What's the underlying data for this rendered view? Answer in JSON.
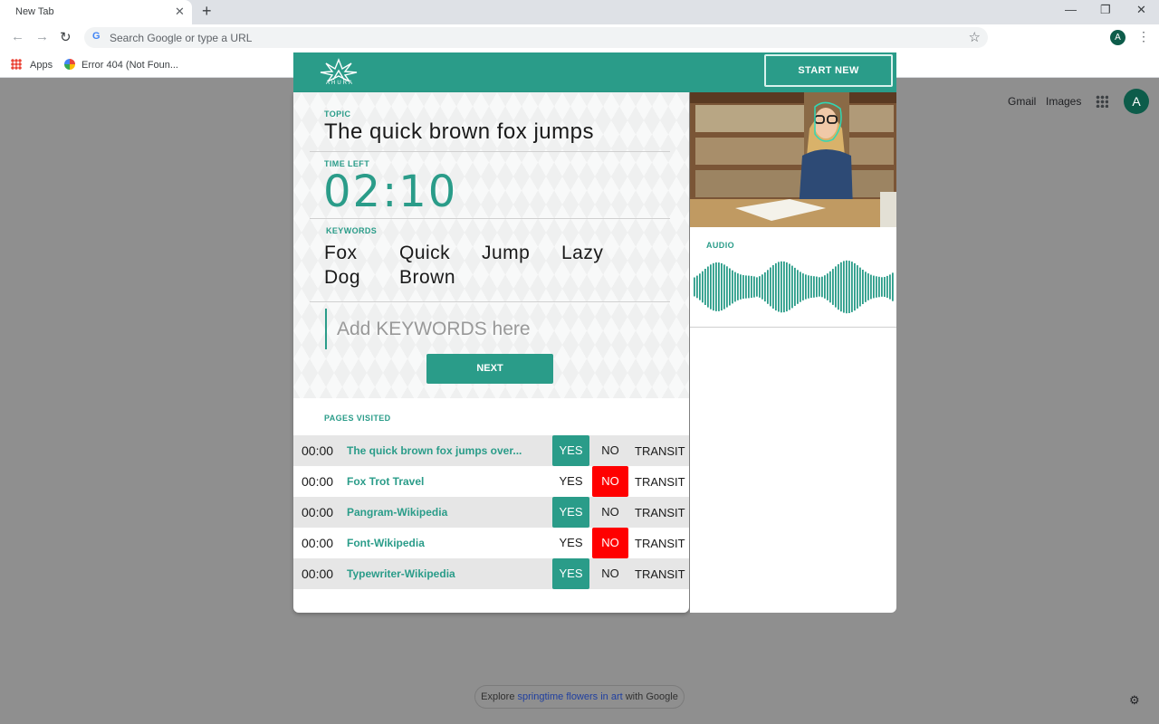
{
  "browser": {
    "tab_title": "New Tab",
    "tab_close": "✕",
    "new_tab": "+",
    "minimize": "—",
    "restore": "❐",
    "close": "✕",
    "back": "←",
    "forward": "→",
    "reload": "↻",
    "google_g": "G",
    "omnibox_placeholder": "Search Google or type a URL",
    "star": "☆",
    "profile_initial": "A",
    "menu": "⋮",
    "bookmarks": [
      {
        "label": "Apps"
      },
      {
        "label": "Error 404 (Not Foun..."
      }
    ]
  },
  "google": {
    "gmail": "Gmail",
    "images": "Images",
    "avatar_initial": "A",
    "explore_prefix": "Explore ",
    "explore_link": "springtime flowers in art",
    "explore_suffix": " with Google",
    "settings": "⚙"
  },
  "app": {
    "brand": "AHURA",
    "start_new": "START NEW",
    "topic_label": "TOPIC",
    "topic": "The quick brown fox jumps",
    "time_left_label": "TIME LEFT",
    "time_left": "02:10",
    "keywords_label": "KEYWORDS",
    "keywords": [
      "Fox",
      "Quick",
      "Jump",
      "Lazy",
      "Dog",
      "Brown"
    ],
    "keyword_placeholder": "Add KEYWORDS here",
    "next": "NEXT",
    "pages_visited_label": "PAGES VISITED",
    "pages": [
      {
        "time": "00:00",
        "title": "The quick brown fox jumps over...",
        "yes": "YES",
        "no": "NO",
        "transit": "TRANSIT",
        "selected": "yes"
      },
      {
        "time": "00:00",
        "title": "Fox Trot Travel",
        "yes": "YES",
        "no": "NO",
        "transit": "TRANSIT",
        "selected": "no"
      },
      {
        "time": "00:00",
        "title": "Pangram-Wikipedia",
        "yes": "YES",
        "no": "NO",
        "transit": "TRANSIT",
        "selected": "yes"
      },
      {
        "time": "00:00",
        "title": "Font-Wikipedia",
        "yes": "YES",
        "no": "NO",
        "transit": "TRANSIT",
        "selected": "no"
      },
      {
        "time": "00:00",
        "title": "Typewriter-Wikipedia",
        "yes": "YES",
        "no": "NO",
        "transit": "TRANSIT",
        "selected": "yes"
      }
    ],
    "audio_label": "AUDIO",
    "colors": {
      "accent": "#2a9c89",
      "no_selected": "#ff0000"
    }
  }
}
